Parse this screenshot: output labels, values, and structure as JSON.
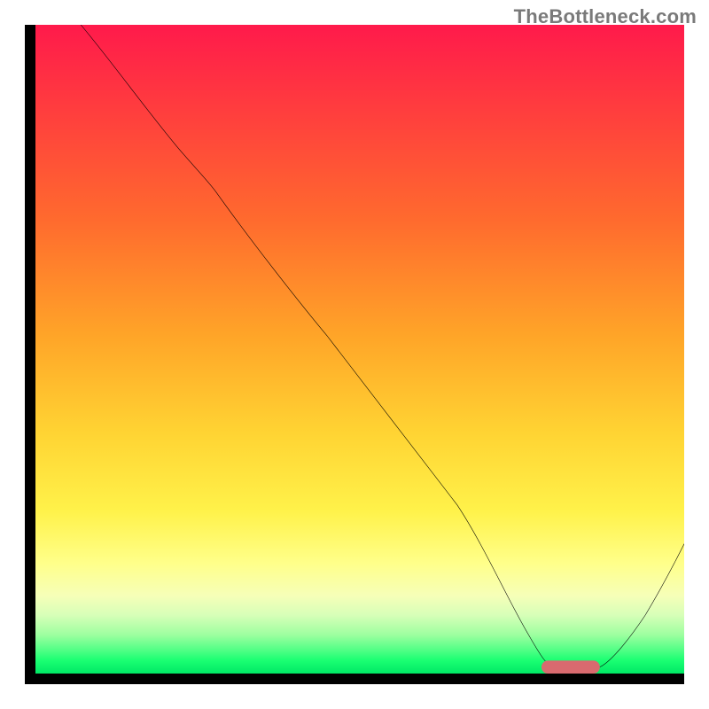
{
  "watermark": "TheBottleneck.com",
  "chart_data": {
    "type": "line",
    "title": "",
    "xlabel": "",
    "ylabel": "",
    "xlim": [
      0,
      100
    ],
    "ylim": [
      0,
      100
    ],
    "series": [
      {
        "name": "bottleneck-curve",
        "x": [
          7,
          15,
          22,
          28,
          35,
          45,
          55,
          65,
          72,
          76,
          80,
          84,
          88,
          94,
          100
        ],
        "y": [
          100,
          90,
          81,
          74,
          65,
          52,
          39,
          26,
          14,
          6,
          1,
          0,
          1,
          9,
          20
        ]
      }
    ],
    "marker": {
      "name": "optimal-range",
      "x_start": 78,
      "x_end": 87,
      "y": 0,
      "color": "#d96a6f"
    },
    "gradient_stops": [
      {
        "pos": 0.0,
        "color": "#ff1a4b"
      },
      {
        "pos": 0.3,
        "color": "#ff6a2e"
      },
      {
        "pos": 0.63,
        "color": "#ffd433"
      },
      {
        "pos": 0.83,
        "color": "#ffff8a"
      },
      {
        "pos": 0.94,
        "color": "#9effa0"
      },
      {
        "pos": 1.0,
        "color": "#00e865"
      }
    ]
  }
}
